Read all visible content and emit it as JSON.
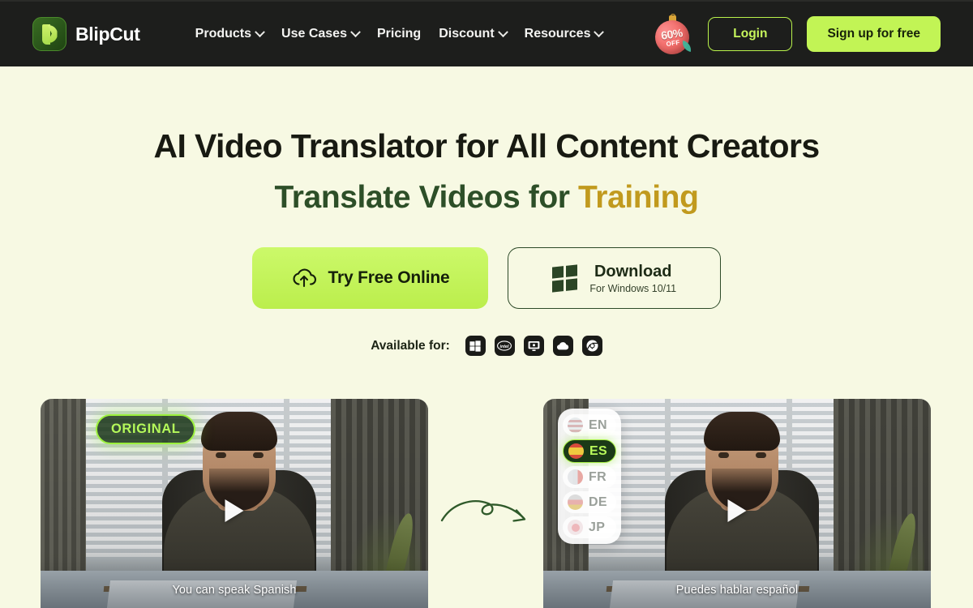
{
  "brand": {
    "name": "BlipCut",
    "logo_icon": "blipcut-logo-icon"
  },
  "nav": {
    "items": [
      {
        "label": "Products",
        "has_dropdown": true
      },
      {
        "label": "Use Cases",
        "has_dropdown": true
      },
      {
        "label": "Pricing",
        "has_dropdown": false
      },
      {
        "label": "Discount",
        "has_dropdown": true
      },
      {
        "label": "Resources",
        "has_dropdown": true
      }
    ]
  },
  "header_actions": {
    "promo": {
      "percent": "60%",
      "off": "OFF",
      "icon": "ornament-discount-icon"
    },
    "login_label": "Login",
    "signup_label": "Sign up for free"
  },
  "hero": {
    "headline": "AI Video Translator for All Content Creators",
    "subheadline_prefix": "Translate Videos for ",
    "subheadline_accent": "Training",
    "cta_primary": {
      "label": "Try Free Online",
      "icon": "cloud-upload-icon"
    },
    "cta_secondary": {
      "title": "Download",
      "subtitle": "For Windows 10/11",
      "icon": "windows-icon"
    },
    "available_label": "Available for:",
    "platforms": [
      {
        "name": "windows-icon"
      },
      {
        "name": "intel-icon"
      },
      {
        "name": "desktop-monitor-icon"
      },
      {
        "name": "cloud-icon"
      },
      {
        "name": "chrome-icon"
      }
    ]
  },
  "videos": {
    "arrow_icon": "curved-arrow-icon",
    "left": {
      "badge": "ORIGINAL",
      "subtitle": "You can speak Spanish",
      "play_icon": "play-icon"
    },
    "right": {
      "subtitle": "Puedes hablar español",
      "play_icon": "play-icon",
      "languages": [
        {
          "code": "EN",
          "flag": "flag-us-icon",
          "selected": false
        },
        {
          "code": "ES",
          "flag": "flag-es-icon",
          "selected": true
        },
        {
          "code": "FR",
          "flag": "flag-fr-icon",
          "selected": false
        },
        {
          "code": "DE",
          "flag": "flag-de-icon",
          "selected": false
        },
        {
          "code": "JP",
          "flag": "flag-jp-icon",
          "selected": false
        }
      ]
    }
  },
  "colors": {
    "header_bg": "#1d1e1c",
    "page_bg": "#f7f9e3",
    "accent_green": "#c2f455",
    "accent_gold": "#c19a1e",
    "dark_green": "#2d4f28",
    "promo_red": "#e3534f"
  }
}
